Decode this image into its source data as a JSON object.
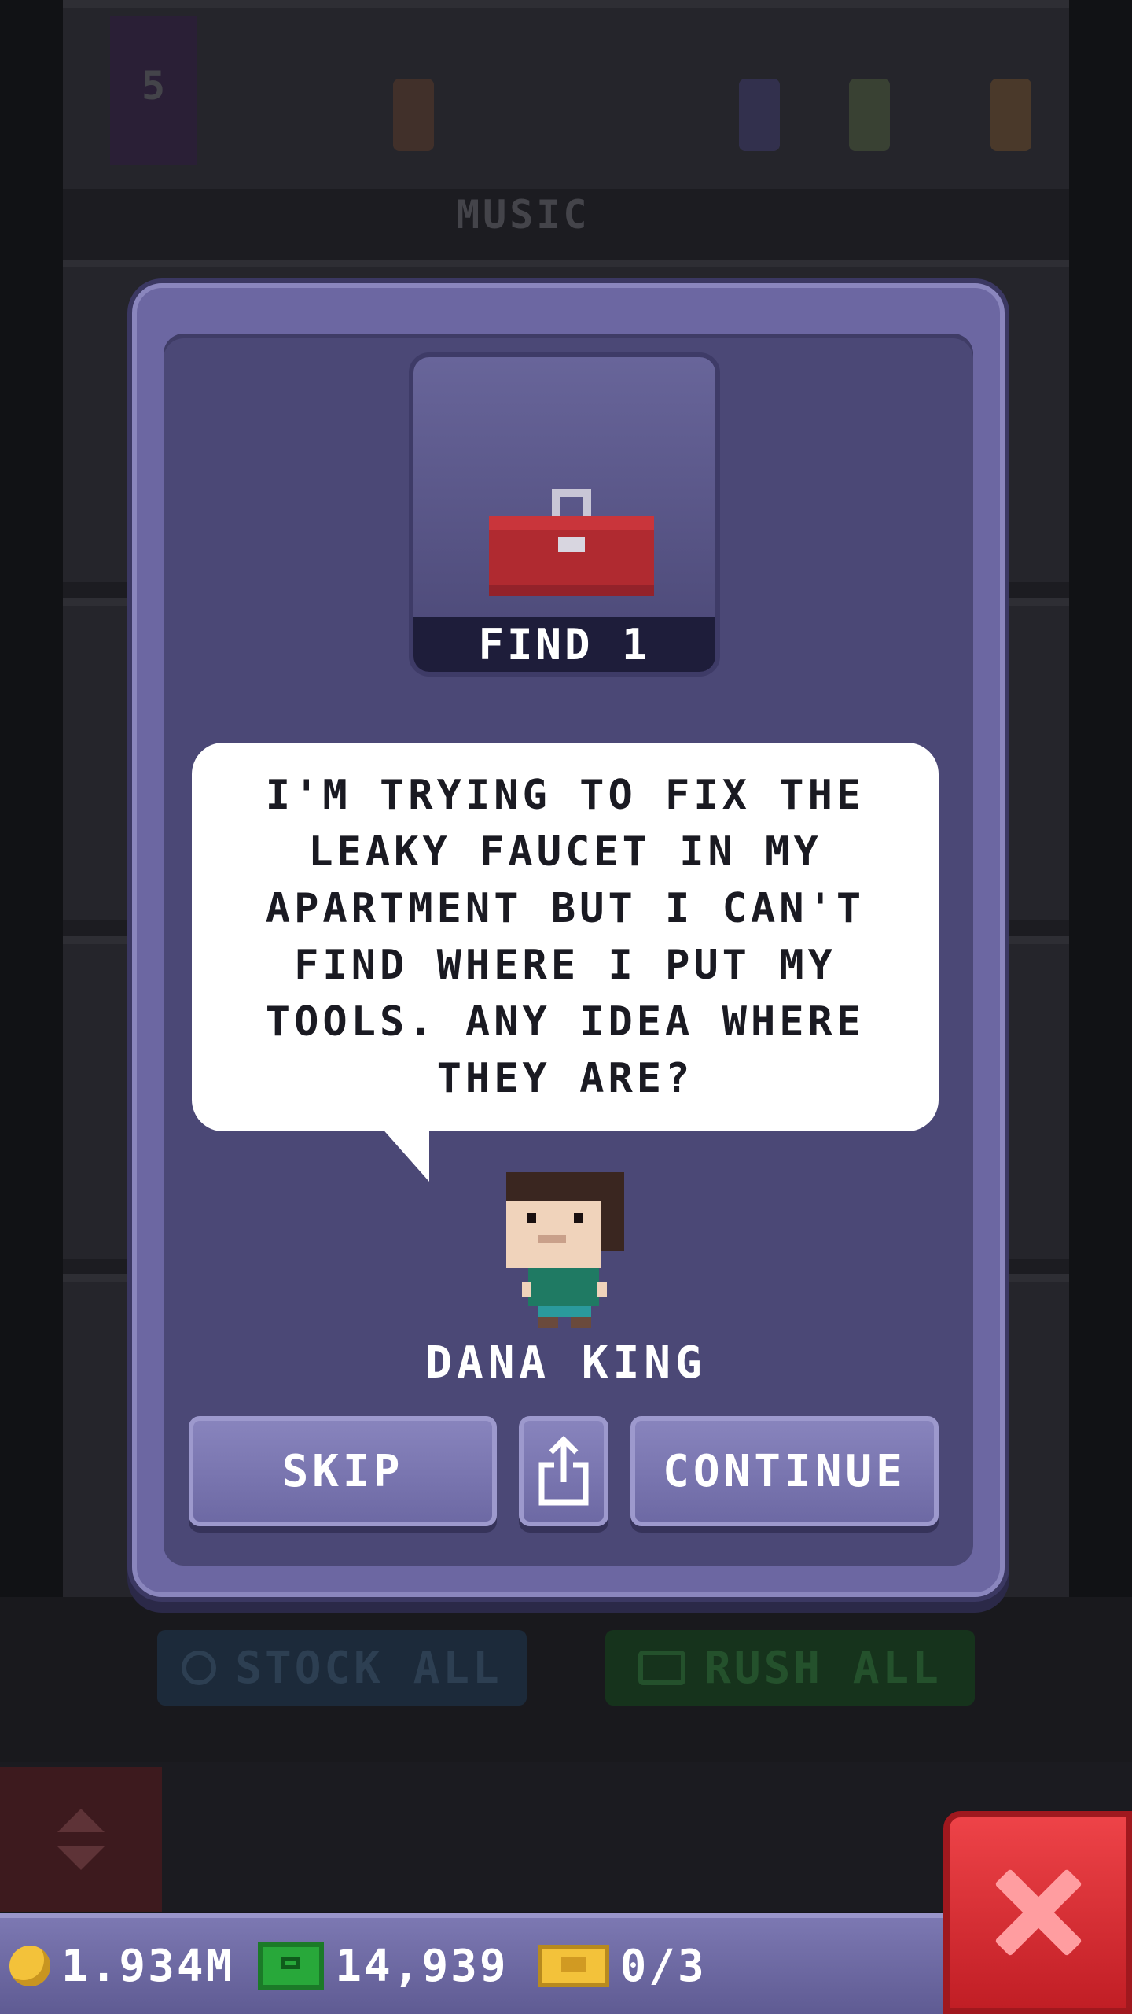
{
  "background": {
    "floor_number": "5",
    "floor_name": "MUSIC",
    "stock_all_label": "STOCK ALL",
    "rush_all_label": "RUSH ALL"
  },
  "mission": {
    "item_icon": "toolbox-icon",
    "label": "FIND 1"
  },
  "dialog": {
    "text": "I'M TRYING TO FIX THE LEAKY FAUCET IN MY APARTMENT BUT I CAN'T FIND WHERE I PUT MY TOOLS. ANY IDEA WHERE THEY ARE?",
    "character_name": "DANA KING"
  },
  "buttons": {
    "skip_label": "SKIP",
    "share_icon": "share-icon",
    "continue_label": "CONTINUE"
  },
  "resources": {
    "coins": "1.934M",
    "bux": "14,939",
    "tickets": "0/3"
  },
  "colors": {
    "modal": "#6c67a2",
    "modal_inner": "#4b4876",
    "close_button": "#e03a40",
    "bux_green": "#28a83a",
    "coin_gold": "#f3c23a"
  }
}
